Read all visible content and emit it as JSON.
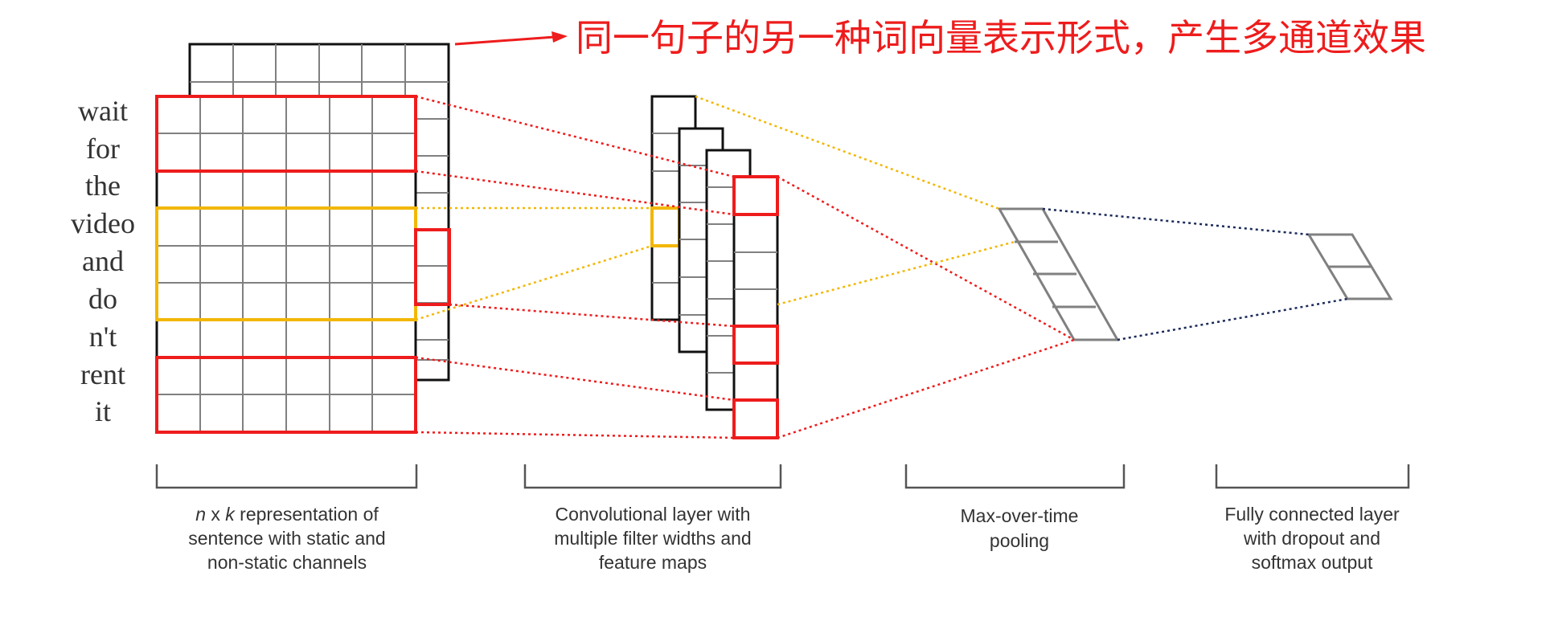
{
  "annotation": {
    "text": "同一句子的另一种词向量表示形式，产生多通道效果",
    "color": "#ee1c1c"
  },
  "sentence": {
    "words": [
      "wait",
      "for",
      "the",
      "video",
      "and",
      "do",
      "n't",
      "rent",
      "it"
    ]
  },
  "captions": {
    "input": {
      "line1_n": "n",
      "line1_x": " x ",
      "line1_k": "k",
      "line1_rest": " representation of",
      "line2": "sentence with static and",
      "line3": "non-static channels"
    },
    "conv": {
      "line1": "Convolutional layer with",
      "line2": "multiple filter widths and",
      "line3": "feature maps"
    },
    "pool": {
      "line1": "Max-over-time",
      "line2": "pooling"
    },
    "fc": {
      "line1": "Fully connected layer",
      "line2": "with dropout and",
      "line3": "softmax output"
    }
  },
  "colors": {
    "red": "#ee1c1c",
    "yellow": "#f2b705",
    "navy": "#1b2a5a",
    "grid": "#808080",
    "black": "#111111",
    "text": "#333333"
  }
}
